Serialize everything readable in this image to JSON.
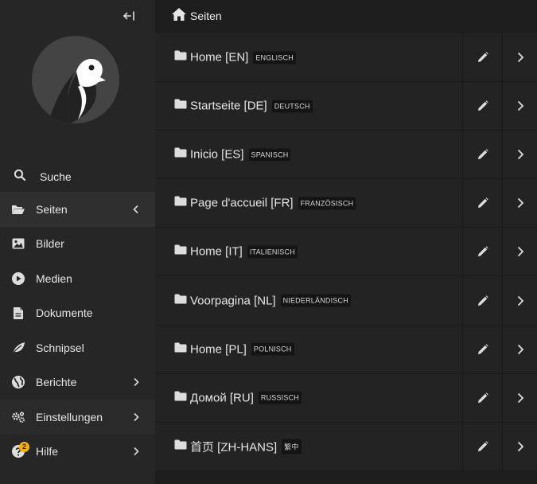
{
  "sidebar": {
    "search_label": "Suche",
    "items": [
      {
        "label": "Seiten",
        "icon": "folder-open-icon",
        "chevron": "left"
      },
      {
        "label": "Bilder",
        "icon": "image-icon",
        "chevron": ""
      },
      {
        "label": "Medien",
        "icon": "play-icon",
        "chevron": ""
      },
      {
        "label": "Dokumente",
        "icon": "document-icon",
        "chevron": ""
      },
      {
        "label": "Schnipsel",
        "icon": "leaf-icon",
        "chevron": ""
      },
      {
        "label": "Berichte",
        "icon": "globe-icon",
        "chevron": "right"
      },
      {
        "label": "Einstellungen",
        "icon": "cogs-icon",
        "chevron": "right"
      },
      {
        "label": "Hilfe",
        "icon": "help-icon",
        "chevron": "right"
      }
    ],
    "help_badge": "2"
  },
  "header": {
    "title": "Seiten"
  },
  "pages": [
    {
      "title": "Home [EN]",
      "locale": "ENGLISCH"
    },
    {
      "title": "Startseite [DE]",
      "locale": "DEUTSCH"
    },
    {
      "title": "Inicio [ES]",
      "locale": "SPANISCH"
    },
    {
      "title": "Page d'accueil [FR]",
      "locale": "FRANZÖSISCH"
    },
    {
      "title": "Home [IT]",
      "locale": "ITALIENISCH"
    },
    {
      "title": "Voorpagina [NL]",
      "locale": "NIEDERLÄNDISCH"
    },
    {
      "title": "Home [PL]",
      "locale": "POLNISCH"
    },
    {
      "title": "Домой [RU]",
      "locale": "RUSSISCH"
    },
    {
      "title": "首页 [ZH-HANS]",
      "locale": "繁中"
    }
  ],
  "colors": {
    "sidebar_bg": "#262626",
    "main_bg": "#1e1e1e",
    "row_bg": "#232323",
    "badge": "#f4b400"
  }
}
